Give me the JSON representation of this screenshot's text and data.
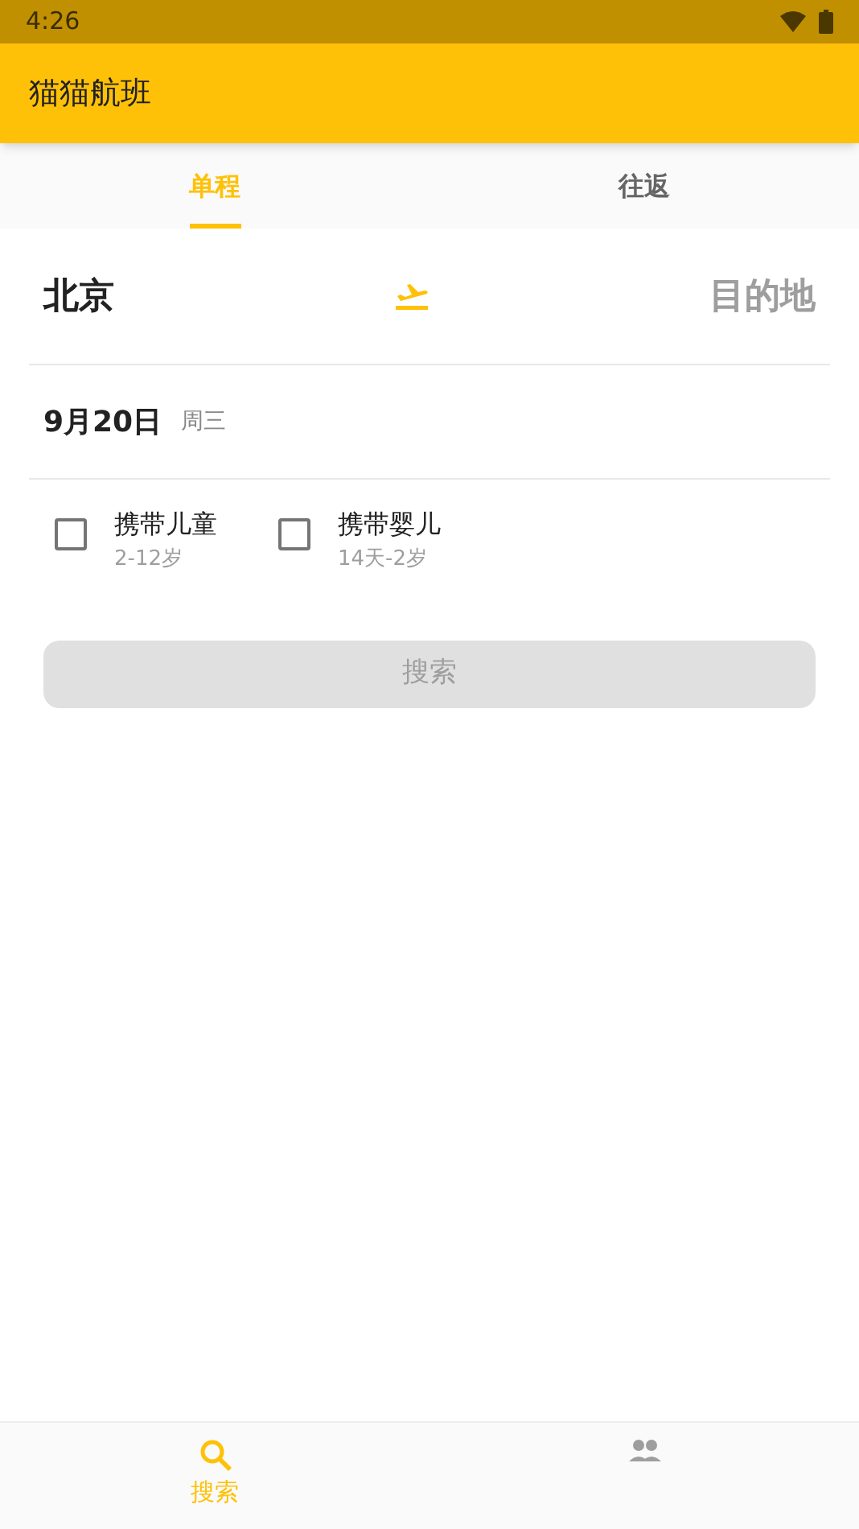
{
  "status_bar": {
    "time": "4:26"
  },
  "app_bar": {
    "title": "猫猫航班"
  },
  "tabs": [
    {
      "label": "单程",
      "selected": true
    },
    {
      "label": "往返",
      "selected": false
    }
  ],
  "route": {
    "origin": "北京",
    "destination": "目的地"
  },
  "date": {
    "day": "9月20日",
    "weekday": "周三"
  },
  "options": [
    {
      "label": "携带儿童",
      "hint": "2-12岁",
      "checked": false
    },
    {
      "label": "携带婴儿",
      "hint": "14天-2岁",
      "checked": false
    }
  ],
  "search_button": {
    "label": "搜索",
    "disabled": true
  },
  "bottom_nav": [
    {
      "kind": "search",
      "label": "搜索",
      "selected": true
    },
    {
      "kind": "people",
      "selected": false
    }
  ]
}
